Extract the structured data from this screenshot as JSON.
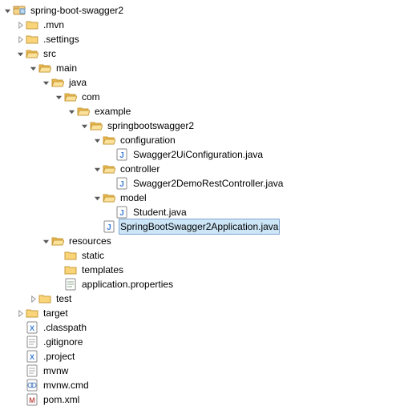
{
  "tree": {
    "label": "spring-boot-swagger2",
    "icon": "project",
    "expanded": true,
    "children": [
      {
        "label": ".mvn",
        "icon": "folder",
        "expanded": false,
        "hasChildren": true
      },
      {
        "label": ".settings",
        "icon": "folder",
        "expanded": false,
        "hasChildren": true
      },
      {
        "label": "src",
        "icon": "folder-open",
        "expanded": true,
        "children": [
          {
            "label": "main",
            "icon": "folder-open",
            "expanded": true,
            "children": [
              {
                "label": "java",
                "icon": "folder-open",
                "expanded": true,
                "children": [
                  {
                    "label": "com",
                    "icon": "folder-open",
                    "expanded": true,
                    "children": [
                      {
                        "label": "example",
                        "icon": "folder-open",
                        "expanded": true,
                        "children": [
                          {
                            "label": "springbootswagger2",
                            "icon": "folder-open",
                            "expanded": true,
                            "children": [
                              {
                                "label": "configuration",
                                "icon": "folder-open",
                                "expanded": true,
                                "children": [
                                  {
                                    "label": "Swagger2UiConfiguration.java",
                                    "icon": "java-file"
                                  }
                                ]
                              },
                              {
                                "label": "controller",
                                "icon": "folder-open",
                                "expanded": true,
                                "children": [
                                  {
                                    "label": "Swagger2DemoRestController.java",
                                    "icon": "java-file"
                                  }
                                ]
                              },
                              {
                                "label": "model",
                                "icon": "folder-open",
                                "expanded": true,
                                "children": [
                                  {
                                    "label": "Student.java",
                                    "icon": "java-file"
                                  }
                                ]
                              },
                              {
                                "label": "SpringBootSwagger2Application.java",
                                "icon": "java-file",
                                "selected": true
                              }
                            ]
                          }
                        ]
                      }
                    ]
                  }
                ]
              },
              {
                "label": "resources",
                "icon": "folder-open",
                "expanded": true,
                "children": [
                  {
                    "label": "static",
                    "icon": "folder"
                  },
                  {
                    "label": "templates",
                    "icon": "folder"
                  },
                  {
                    "label": "application.properties",
                    "icon": "properties-file"
                  }
                ]
              }
            ]
          },
          {
            "label": "test",
            "icon": "folder",
            "expanded": false,
            "hasChildren": true
          }
        ]
      },
      {
        "label": "target",
        "icon": "folder",
        "expanded": false,
        "hasChildren": true
      },
      {
        "label": ".classpath",
        "icon": "xml-file"
      },
      {
        "label": ".gitignore",
        "icon": "text-file"
      },
      {
        "label": ".project",
        "icon": "xml-file"
      },
      {
        "label": "mvnw",
        "icon": "text-file"
      },
      {
        "label": "mvnw.cmd",
        "icon": "cmd-file"
      },
      {
        "label": "pom.xml",
        "icon": "maven-file"
      }
    ]
  }
}
